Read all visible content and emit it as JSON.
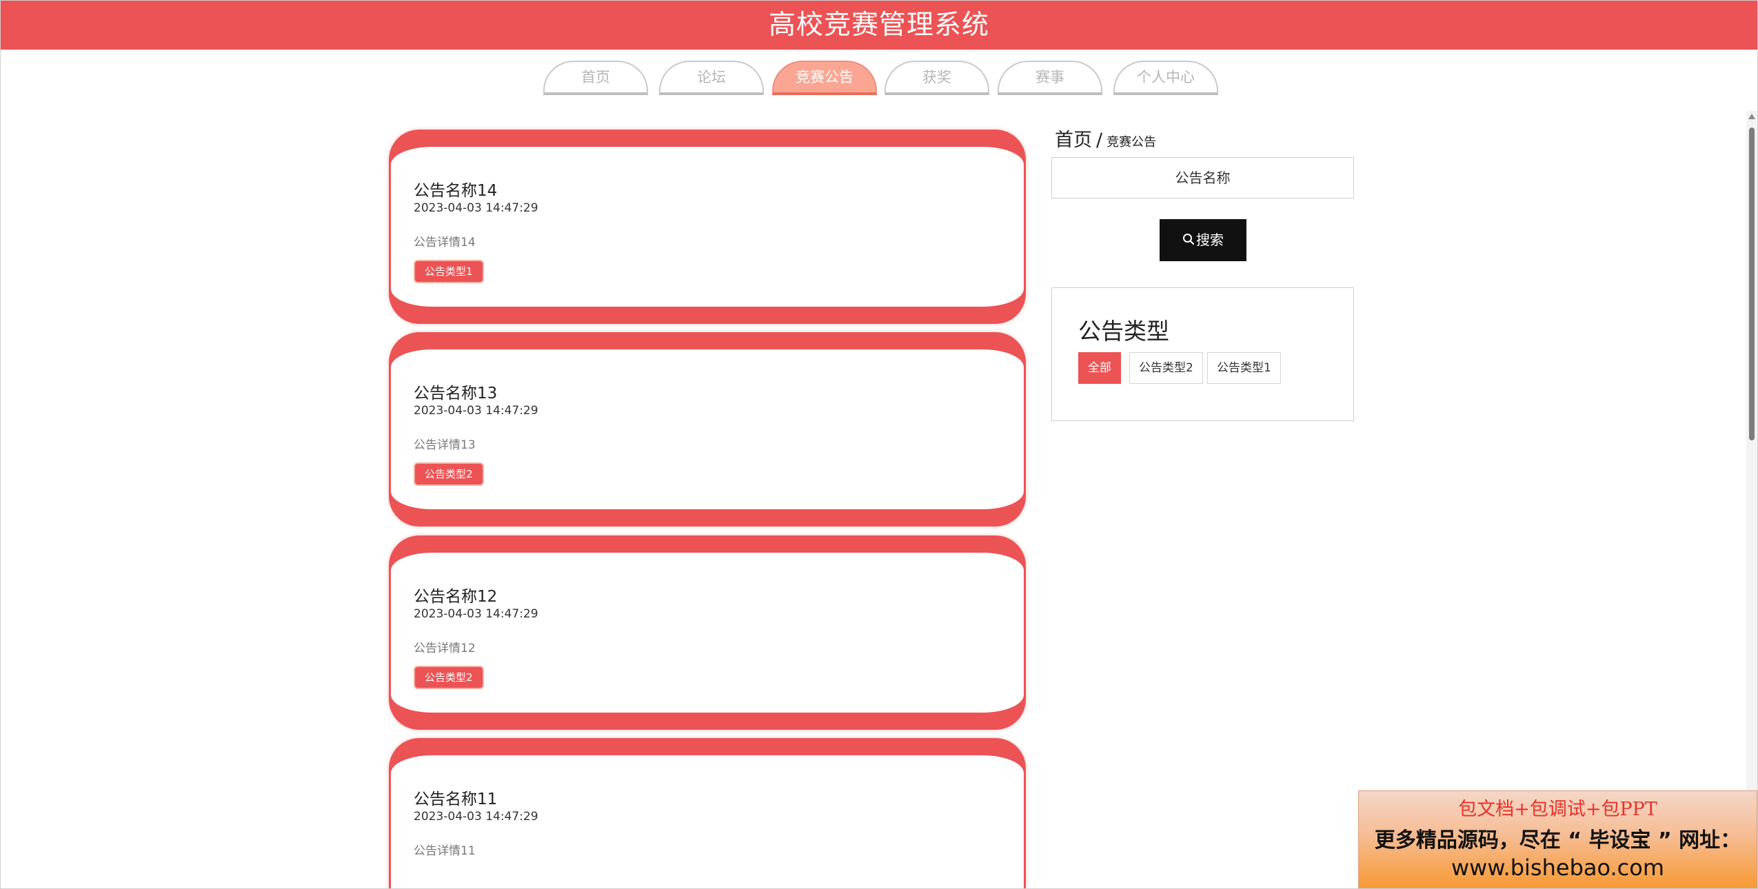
{
  "app": {
    "title": "高校竞赛管理系统"
  },
  "nav": {
    "tabs": [
      {
        "label": "首页"
      },
      {
        "label": "论坛"
      },
      {
        "label": "竞赛公告",
        "active": true
      },
      {
        "label": "获奖"
      },
      {
        "label": "赛事"
      },
      {
        "label": "个人中心"
      }
    ]
  },
  "notices": [
    {
      "title": "公告名称14",
      "time": "2023-04-03 14:47:29",
      "detail": "公告详情14",
      "type": "公告类型1"
    },
    {
      "title": "公告名称13",
      "time": "2023-04-03 14:47:29",
      "detail": "公告详情13",
      "type": "公告类型2"
    },
    {
      "title": "公告名称12",
      "time": "2023-04-03 14:47:29",
      "detail": "公告详情12",
      "type": "公告类型2"
    },
    {
      "title": "公告名称11",
      "time": "2023-04-03 14:47:29",
      "detail": "公告详情11",
      "type": ""
    }
  ],
  "breadcrumb": {
    "home": "首页",
    "separator": "/",
    "current": "竞赛公告"
  },
  "search": {
    "placeholder": "公告名称",
    "value": "",
    "button_label": "搜索"
  },
  "filter": {
    "title": "公告类型",
    "chips": [
      {
        "label": "全部",
        "active": true
      },
      {
        "label": "公告类型2",
        "active": false
      },
      {
        "label": "公告类型1",
        "active": false
      }
    ]
  },
  "promo": {
    "line1": "包文档+包调试+包PPT",
    "line2": "更多精品源码，尽在 “ 毕设宝 ” 网址：",
    "line3": "www.bishebao.com"
  },
  "colors": {
    "brand": "#ec5354",
    "active_tab": "#fba693",
    "search_button": "#111111"
  },
  "icons": {
    "search": "magnifier-icon",
    "scroll_up": "triangle-up-icon"
  }
}
